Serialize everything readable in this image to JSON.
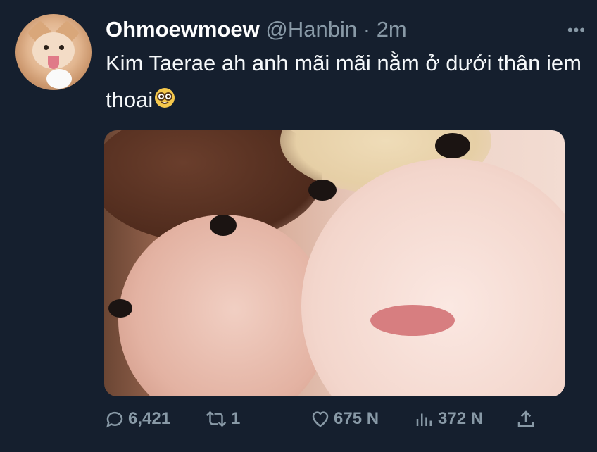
{
  "tweet": {
    "display_name": "Ohmoewmoew",
    "handle": "@Hanbin",
    "separator": "·",
    "time": "2m",
    "more_label": "•••",
    "text": "Kim Taerae ah anh mãi mãi nằm ở dưới thân iem thoai",
    "emoji": "nerd-face-emoji"
  },
  "avatar": {
    "icon": "cat-avatar"
  },
  "media": {
    "description_icon": "photo"
  },
  "actions": {
    "reply_count": "6,421",
    "retweet_count": "1",
    "like_count": "675 N",
    "views_count": "372 N"
  },
  "colors": {
    "background": "#151f2e",
    "text": "#f5f8fa",
    "muted": "#8899a6"
  }
}
